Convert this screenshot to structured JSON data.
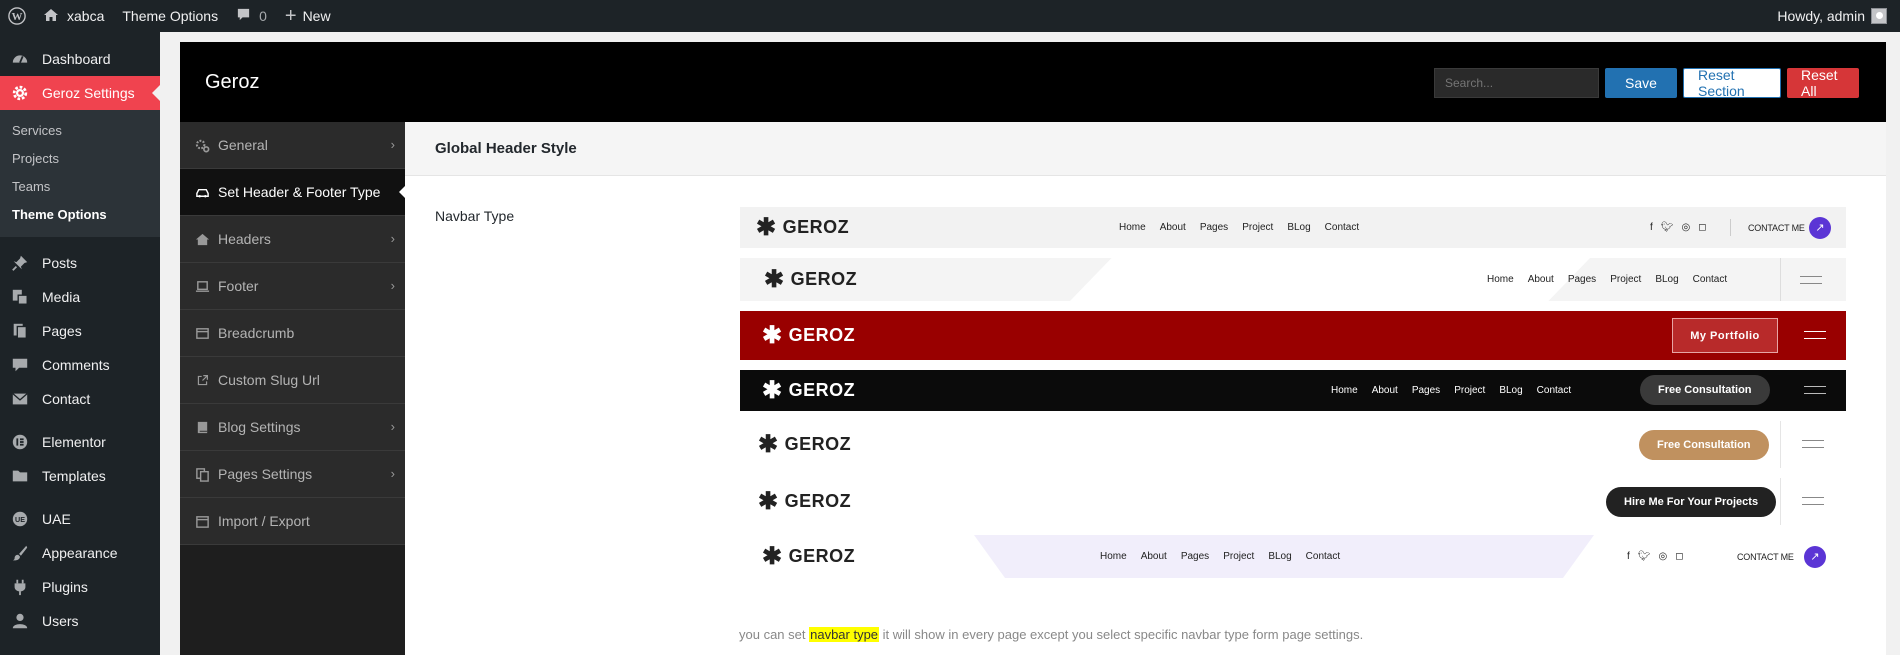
{
  "adminbar": {
    "site_name": "xabca",
    "theme_options": "Theme Options",
    "comments_count": "0",
    "new_label": "New",
    "howdy": "Howdy, admin"
  },
  "adminmenu": {
    "dashboard": "Dashboard",
    "geroz_settings": "Geroz Settings",
    "sub": [
      "Services",
      "Projects",
      "Teams",
      "Theme Options"
    ],
    "posts": "Posts",
    "media": "Media",
    "pages": "Pages",
    "comments": "Comments",
    "contact": "Contact",
    "elementor": "Elementor",
    "templates": "Templates",
    "uae": "UAE",
    "appearance": "Appearance",
    "plugins": "Plugins",
    "users": "Users"
  },
  "panel": {
    "title": "Geroz",
    "search_placeholder": "Search...",
    "save": "Save",
    "reset_section": "Reset Section",
    "reset_all": "Reset All"
  },
  "nav": [
    {
      "label": "General"
    },
    {
      "label": "Set Header & Footer Type"
    },
    {
      "label": "Headers"
    },
    {
      "label": "Footer"
    },
    {
      "label": "Breadcrumb"
    },
    {
      "label": "Custom Slug Url"
    },
    {
      "label": "Blog Settings"
    },
    {
      "label": "Pages Settings"
    },
    {
      "label": "Import / Export"
    }
  ],
  "content": {
    "section_title": "Global Header Style",
    "field_label": "Navbar Type",
    "hint_before": "you can set ",
    "hint_highlight": "navbar type",
    "hint_after": " it will show in every page except you select specific navbar type form page settings."
  },
  "navbars": {
    "logo": "GEROZ",
    "links": [
      "Home",
      "About",
      "Pages",
      "Project",
      "BLog",
      "Contact"
    ],
    "contact_me": "CONTACT ME",
    "my_portfolio": "My Portfolio",
    "free_consultation": "Free Consultation",
    "hire_me": "Hire Me For Your Projects"
  },
  "colors": {
    "accent": "#f0434f",
    "save_blue": "#2271b1",
    "reset_red": "#d63638",
    "nav3_bg": "#990000",
    "nav5_pill": "#c0915f",
    "arrow_purple": "#5b35d5"
  }
}
